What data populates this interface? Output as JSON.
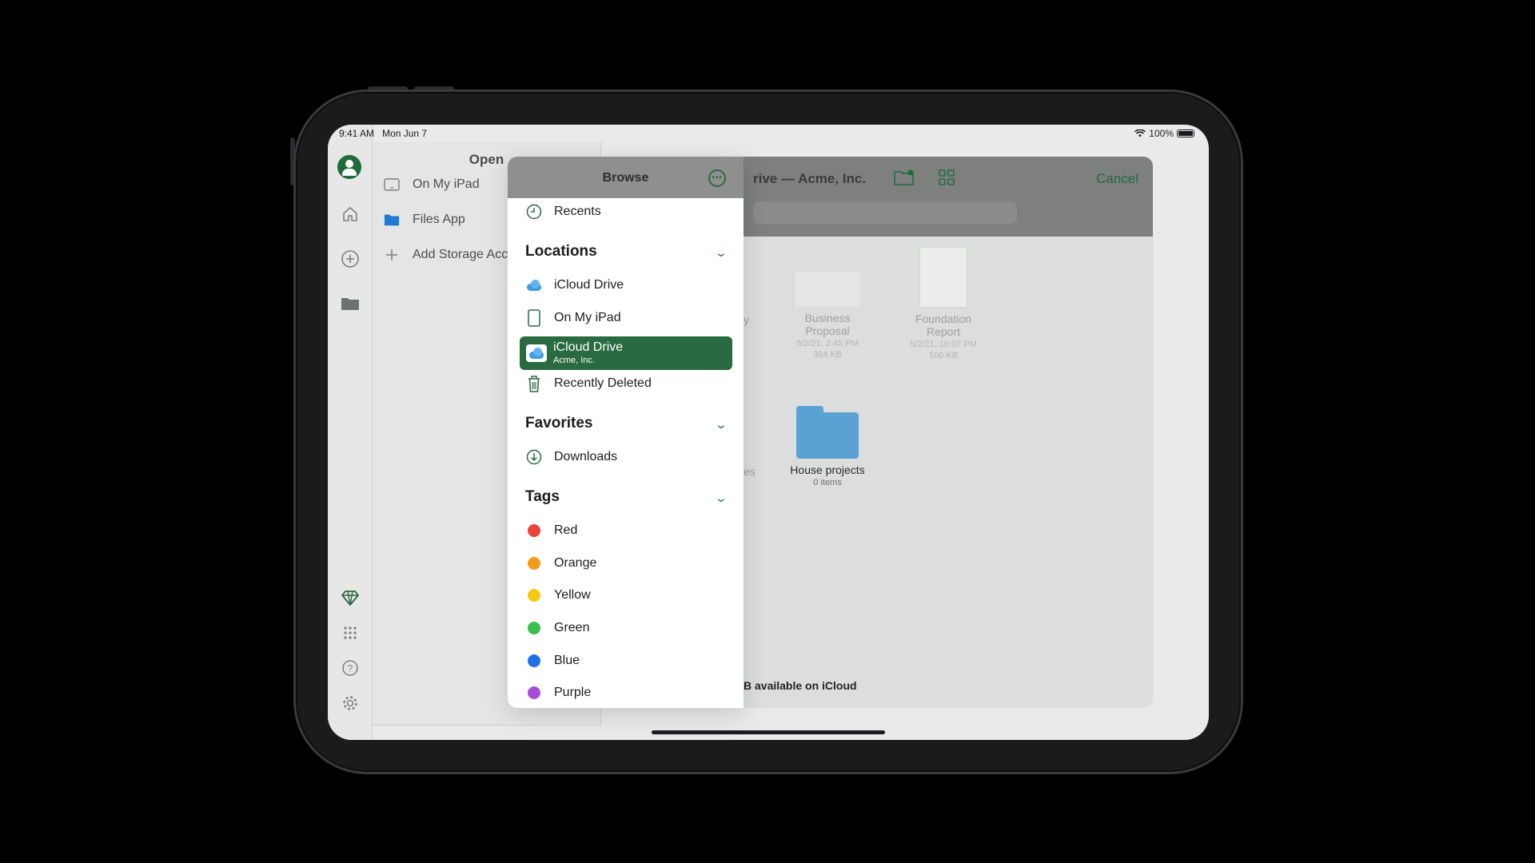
{
  "status": {
    "time": "9:41 AM",
    "date": "Mon Jun 7",
    "battery": "100%"
  },
  "rail": {
    "icons": [
      "profile-avatar",
      "home-icon",
      "add-icon",
      "folder-icon",
      "premium-icon",
      "apps-grid-icon",
      "help-icon",
      "settings-icon"
    ]
  },
  "open_panel": {
    "title": "Open",
    "items": [
      {
        "label": "On My iPad",
        "icon": "ipad-icon"
      },
      {
        "label": "Files App",
        "icon": "folder-icon"
      },
      {
        "label": "Add Storage Acc",
        "icon": "plus-icon"
      }
    ]
  },
  "file_browser": {
    "title": "rive — Acme, Inc.",
    "cancel": "Cancel",
    "storage_text": "B available on iCloud",
    "partial_labels": [
      "y",
      "es"
    ],
    "items": [
      {
        "name": "Business Proposal",
        "name_l1": "Business",
        "name_l2": "Proposal",
        "date": "5/2/21, 2:45 PM",
        "size": "384 KB"
      },
      {
        "name": "Foundation Report",
        "name_l1": "Foundation",
        "name_l2": "Report",
        "date": "5/2/21, 10:07 PM",
        "size": "106 KB"
      },
      {
        "name": "House projects",
        "count": "0 items"
      }
    ]
  },
  "browse": {
    "title": "Browse",
    "recents": "Recents",
    "locations_header": "Locations",
    "locations": [
      {
        "label": "iCloud Drive",
        "icon": "icloud-icon"
      },
      {
        "label": "On My iPad",
        "icon": "ipad-icon"
      }
    ],
    "selected": {
      "label": "iCloud Drive",
      "sub": "Acme, Inc."
    },
    "recently_deleted": "Recently Deleted",
    "favorites_header": "Favorites",
    "downloads": "Downloads",
    "tags_header": "Tags",
    "tags": [
      {
        "label": "Red",
        "color": "#e8443a"
      },
      {
        "label": "Orange",
        "color": "#f39a1c"
      },
      {
        "label": "Yellow",
        "color": "#f6c90e"
      },
      {
        "label": "Green",
        "color": "#3cbf4e"
      },
      {
        "label": "Blue",
        "color": "#1f72e6"
      },
      {
        "label": "Purple",
        "color": "#a54fd9"
      }
    ]
  },
  "colors": {
    "accent": "#2a6a40"
  }
}
